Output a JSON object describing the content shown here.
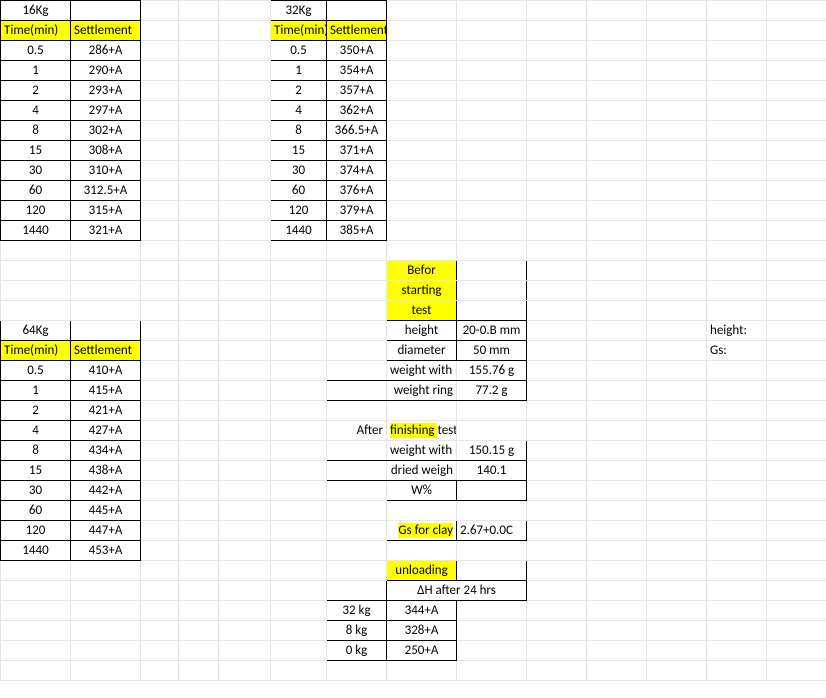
{
  "load16": {
    "title": "16Kg",
    "h_time": "Time(min)",
    "h_set": "Settlement",
    "rows": [
      {
        "t": "0.5",
        "s": "286+A"
      },
      {
        "t": "1",
        "s": "290+A"
      },
      {
        "t": "2",
        "s": "293+A"
      },
      {
        "t": "4",
        "s": "297+A"
      },
      {
        "t": "8",
        "s": "302+A"
      },
      {
        "t": "15",
        "s": "308+A"
      },
      {
        "t": "30",
        "s": "310+A"
      },
      {
        "t": "60",
        "s": "312.5+A"
      },
      {
        "t": "120",
        "s": "315+A"
      },
      {
        "t": "1440",
        "s": "321+A"
      }
    ]
  },
  "load32": {
    "title": "32Kg",
    "h_time": "Time(min)",
    "h_set": "Settlement",
    "rows": [
      {
        "t": "0.5",
        "s": "350+A"
      },
      {
        "t": "1",
        "s": "354+A"
      },
      {
        "t": "2",
        "s": "357+A"
      },
      {
        "t": "4",
        "s": "362+A"
      },
      {
        "t": "8",
        "s": "366.5+A"
      },
      {
        "t": "15",
        "s": "371+A"
      },
      {
        "t": "30",
        "s": "374+A"
      },
      {
        "t": "60",
        "s": "376+A"
      },
      {
        "t": "120",
        "s": "379+A"
      },
      {
        "t": "1440",
        "s": "385+A"
      }
    ]
  },
  "load64": {
    "title": "64Kg",
    "h_time": "Time(min)",
    "h_set": "Settlement",
    "rows": [
      {
        "t": "0.5",
        "s": "410+A"
      },
      {
        "t": "1",
        "s": "415+A"
      },
      {
        "t": "2",
        "s": "421+A"
      },
      {
        "t": "4",
        "s": "427+A"
      },
      {
        "t": "8",
        "s": "434+A"
      },
      {
        "t": "15",
        "s": "438+A"
      },
      {
        "t": "30",
        "s": "442+A"
      },
      {
        "t": "60",
        "s": "445+A"
      },
      {
        "t": "120",
        "s": "447+A"
      },
      {
        "t": "1440",
        "s": "453+A"
      }
    ]
  },
  "before": {
    "title_l1": "Befor",
    "title_l2": "starting",
    "title_l3": "test",
    "height_l": "height",
    "height_v": "20-0.B mm",
    "diam_l": "diameter",
    "diam_v": "50 mm",
    "wwr_l": "weight with ring",
    "wwr_v": "155.76 g",
    "wr_l": "weight ring",
    "wr_v": "77.2 g"
  },
  "after": {
    "title_pre": "After",
    "title_hl": " finishing ",
    "title_post": "test",
    "wwr_l": "weight with r",
    "wwr_v": "150.15 g",
    "dw_l": "dried weigh",
    "dw_v": "140.1",
    "wpc_l": "W%"
  },
  "gs": {
    "label_pre": "Gs for clay",
    "value": "2.67+0.0C"
  },
  "unload": {
    "title": "unloading",
    "sub": "ΔH after 24 hrs",
    "rows": [
      {
        "l": "32 kg",
        "v": "344+A"
      },
      {
        "l": "8 kg",
        "v": "328+A"
      },
      {
        "l": "0 kg",
        "v": "250+A"
      }
    ]
  },
  "right": {
    "height": "height:",
    "gs": "Gs:"
  }
}
